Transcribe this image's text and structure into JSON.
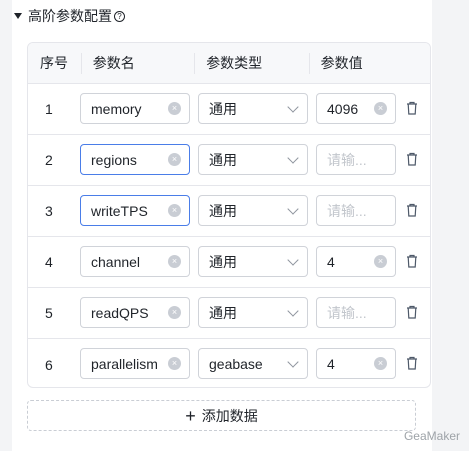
{
  "section": {
    "title": "高阶参数配置",
    "help": "?"
  },
  "table": {
    "columns": [
      "序号",
      "参数名",
      "参数类型",
      "参数值"
    ],
    "rows": [
      {
        "index": "1",
        "name": "memory",
        "type": "通用",
        "value": "4096",
        "value_placeholder": "",
        "name_focused": false
      },
      {
        "index": "2",
        "name": "regions",
        "type": "通用",
        "value": "",
        "value_placeholder": "请输...",
        "name_focused": true
      },
      {
        "index": "3",
        "name": "writeTPS",
        "type": "通用",
        "value": "",
        "value_placeholder": "请输...",
        "name_focused": true
      },
      {
        "index": "4",
        "name": "channel",
        "type": "通用",
        "value": "4",
        "value_placeholder": "",
        "name_focused": false
      },
      {
        "index": "5",
        "name": "readQPS",
        "type": "通用",
        "value": "",
        "value_placeholder": "请输...",
        "name_focused": false
      },
      {
        "index": "6",
        "name": "parallelism",
        "type": "geabase",
        "value": "4",
        "value_placeholder": "",
        "name_focused": false
      }
    ]
  },
  "add_button": {
    "label": "添加数据"
  },
  "watermark": "GeaMaker"
}
